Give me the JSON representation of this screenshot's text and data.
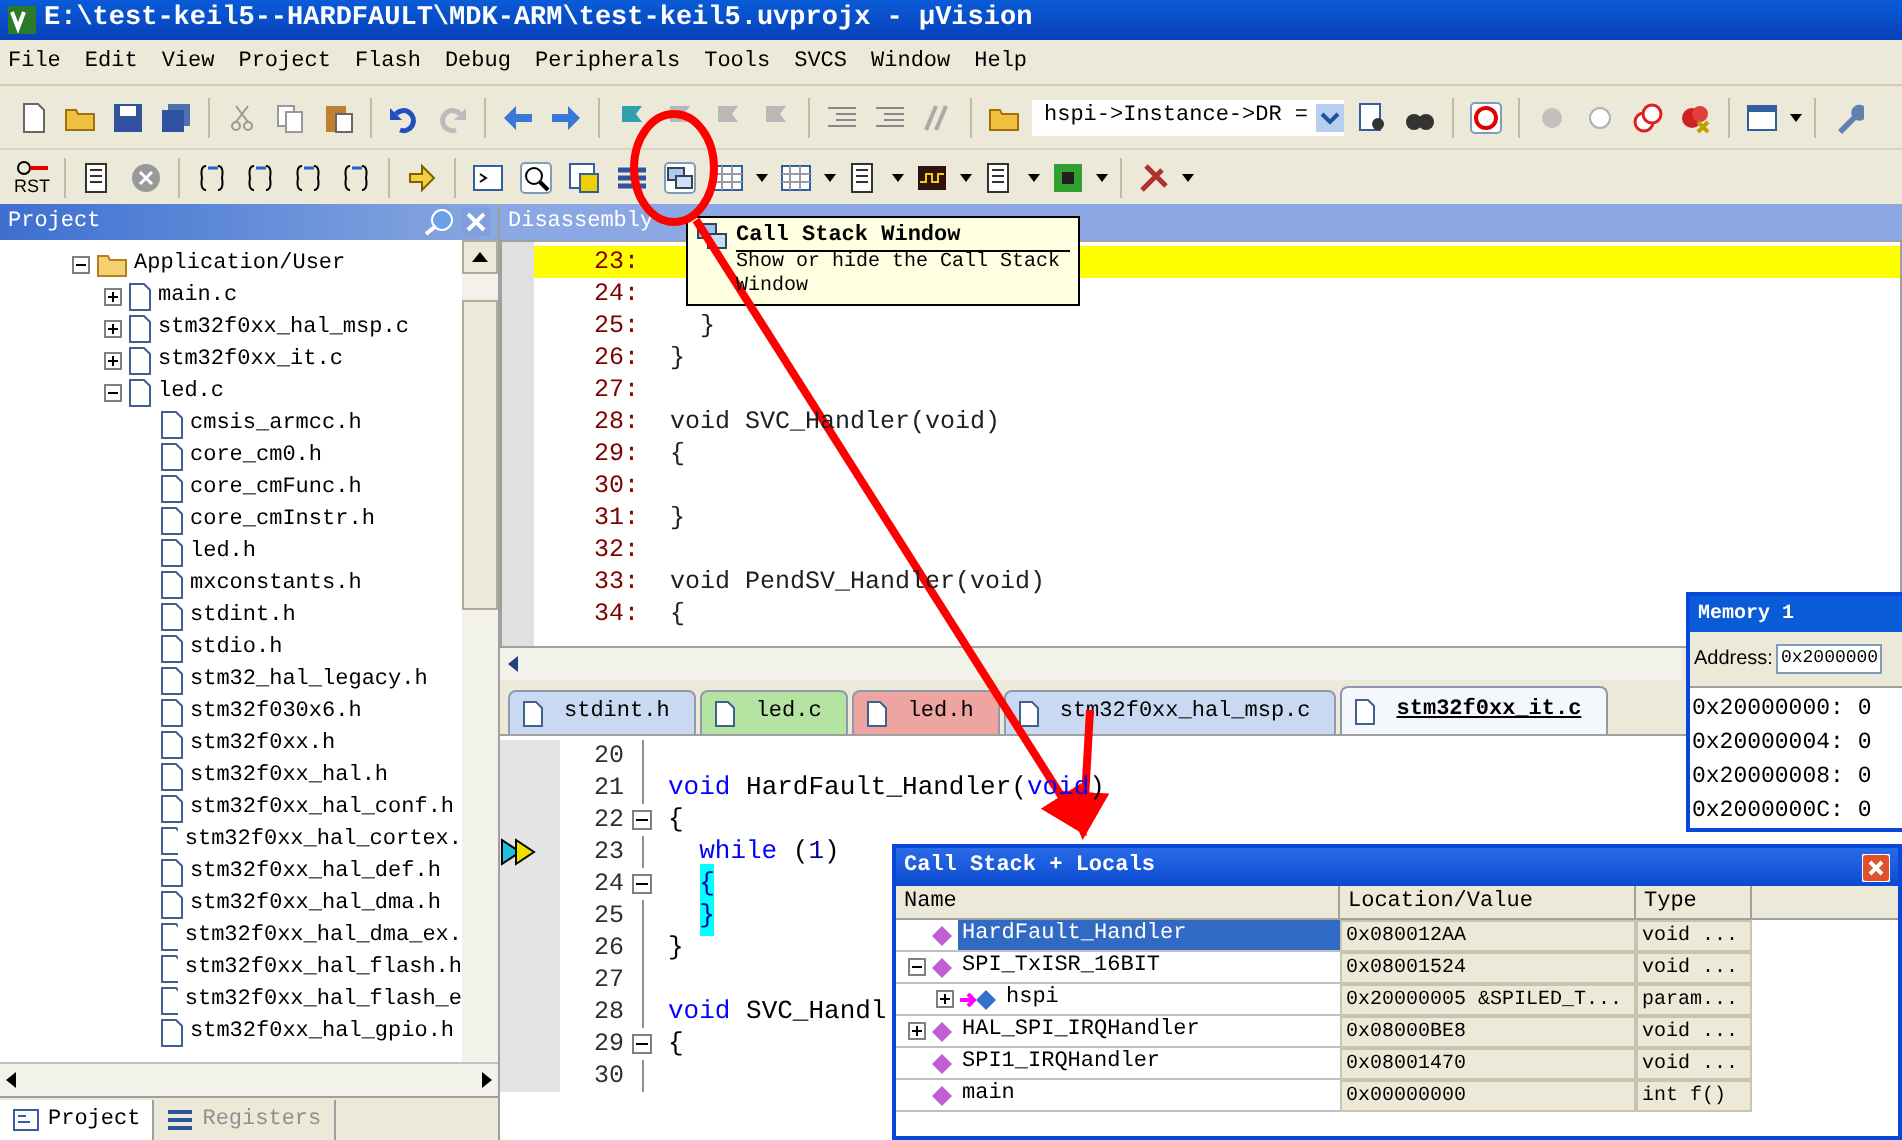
{
  "window": {
    "title": "E:\\test-keil5--HARDFAULT\\MDK-ARM\\test-keil5.uvprojx - µVision"
  },
  "menu": [
    "File",
    "Edit",
    "View",
    "Project",
    "Flash",
    "Debug",
    "Peripherals",
    "Tools",
    "SVCS",
    "Window",
    "Help"
  ],
  "toolbar": {
    "find_field": {
      "value": "hspi->Instance->DR ="
    },
    "reset_label": "RST"
  },
  "project_panel": {
    "title": "Project",
    "tree": [
      {
        "label": "Application/User",
        "kind": "folder",
        "expanded": true,
        "children": [
          {
            "label": "main.c",
            "kind": "file",
            "expanded": false
          },
          {
            "label": "stm32f0xx_hal_msp.c",
            "kind": "file",
            "expanded": false
          },
          {
            "label": "stm32f0xx_it.c",
            "kind": "file",
            "expanded": false
          },
          {
            "label": "led.c",
            "kind": "file",
            "expanded": true,
            "children": [
              {
                "label": "cmsis_armcc.h",
                "kind": "file"
              },
              {
                "label": "core_cm0.h",
                "kind": "file"
              },
              {
                "label": "core_cmFunc.h",
                "kind": "file"
              },
              {
                "label": "core_cmInstr.h",
                "kind": "file"
              },
              {
                "label": "led.h",
                "kind": "file"
              },
              {
                "label": "mxconstants.h",
                "kind": "file"
              },
              {
                "label": "stdint.h",
                "kind": "file"
              },
              {
                "label": "stdio.h",
                "kind": "file"
              },
              {
                "label": "stm32_hal_legacy.h",
                "kind": "file"
              },
              {
                "label": "stm32f030x6.h",
                "kind": "file"
              },
              {
                "label": "stm32f0xx.h",
                "kind": "file"
              },
              {
                "label": "stm32f0xx_hal.h",
                "kind": "file"
              },
              {
                "label": "stm32f0xx_hal_conf.h",
                "kind": "file"
              },
              {
                "label": "stm32f0xx_hal_cortex.",
                "kind": "file"
              },
              {
                "label": "stm32f0xx_hal_def.h",
                "kind": "file"
              },
              {
                "label": "stm32f0xx_hal_dma.h",
                "kind": "file"
              },
              {
                "label": "stm32f0xx_hal_dma_ex.",
                "kind": "file"
              },
              {
                "label": "stm32f0xx_hal_flash.h",
                "kind": "file"
              },
              {
                "label": "stm32f0xx_hal_flash_e",
                "kind": "file"
              },
              {
                "label": "stm32f0xx_hal_gpio.h",
                "kind": "file"
              }
            ]
          }
        ]
      }
    ],
    "tabs": [
      {
        "label": "Project",
        "selected": true
      },
      {
        "label": "Registers",
        "selected": false
      }
    ]
  },
  "disassembly": {
    "title": "Disassembly",
    "lines": [
      {
        "number": "23:",
        "current": true
      },
      {
        "number": "24:",
        "current": false
      },
      {
        "number": "25:",
        "text": "  }",
        "current": false
      },
      {
        "number": "26:",
        "text": "}",
        "current": false
      },
      {
        "number": "27:",
        "current": false
      },
      {
        "number": "28:",
        "text": "void SVC_Handler(void)",
        "current": false
      },
      {
        "number": "29:",
        "text": "{",
        "current": false
      },
      {
        "number": "30:",
        "current": false
      },
      {
        "number": "31:",
        "text": "}",
        "current": false
      },
      {
        "number": "32:",
        "current": false
      },
      {
        "number": "33:",
        "text": "void PendSV_Handler(void)",
        "current": false
      },
      {
        "number": "34:",
        "text": "{",
        "current": false
      }
    ]
  },
  "tooltip": {
    "title": "Call Stack Window",
    "text": "Show or hide the Call Stack Window"
  },
  "editor": {
    "tabs": [
      {
        "label": "stdint.h",
        "color": "#c9d9f1",
        "selected": false
      },
      {
        "label": "led.c",
        "color": "#b5e3a1",
        "selected": false
      },
      {
        "label": "led.h",
        "color": "#eea4a0",
        "selected": false
      },
      {
        "label": "stm32f0xx_hal_msp.c",
        "color": "#c9d9f1",
        "selected": false
      },
      {
        "label": "stm32f0xx_it.c",
        "color": "#f4f7fc",
        "selected": true
      }
    ],
    "lines": [
      {
        "number": "20",
        "fold": false,
        "current": false
      },
      {
        "number": "21",
        "fold": false,
        "current": false,
        "tokens": [
          {
            "text": "void",
            "kind": "keyword"
          },
          {
            "text": " HardFault_Handler(",
            "kind": "plain"
          },
          {
            "text": "void",
            "kind": "keyword"
          },
          {
            "text": ")",
            "kind": "plain"
          }
        ]
      },
      {
        "number": "22",
        "fold": true,
        "current": false,
        "tokens": [
          {
            "text": "{",
            "kind": "plain"
          }
        ]
      },
      {
        "number": "23",
        "fold": false,
        "current": true,
        "tokens": [
          {
            "text": "  while",
            "kind": "keyword"
          },
          {
            "text": " (",
            "kind": "plain"
          },
          {
            "text": "1",
            "kind": "number"
          },
          {
            "text": ")",
            "kind": "plain"
          }
        ]
      },
      {
        "number": "24",
        "fold": true,
        "current": false,
        "tokens": [
          {
            "text": "  {",
            "kind": "brace_match"
          }
        ]
      },
      {
        "number": "25",
        "fold": false,
        "current": false,
        "tokens": [
          {
            "text": "  }",
            "kind": "brace_match"
          }
        ]
      },
      {
        "number": "26",
        "fold": false,
        "current": false,
        "tokens": [
          {
            "text": "}",
            "kind": "plain"
          }
        ]
      },
      {
        "number": "27",
        "fold": false,
        "current": false
      },
      {
        "number": "28",
        "fold": false,
        "current": false,
        "tokens": [
          {
            "text": "void",
            "kind": "keyword"
          },
          {
            "text": " SVC_Handl",
            "kind": "plain"
          }
        ]
      },
      {
        "number": "29",
        "fold": true,
        "current": false,
        "tokens": [
          {
            "text": "{",
            "kind": "plain"
          }
        ]
      },
      {
        "number": "30",
        "fold": false,
        "current": false
      }
    ]
  },
  "memory": {
    "title": "Memory 1",
    "address_label": "Address:",
    "address": "0x2000000",
    "rows": [
      "0x20000000: 0",
      "0x20000004: 0",
      "0x20000008: 0",
      "0x2000000C: 0"
    ]
  },
  "call_stack": {
    "title": "Call Stack + Locals",
    "columns": [
      "Name",
      "Location/Value",
      "Type"
    ],
    "rows": [
      {
        "name": "HardFault_Handler",
        "kind": "function",
        "selected": true,
        "value": "0x080012AA",
        "type": "void ..."
      },
      {
        "name": "SPI_TxISR_16BIT",
        "kind": "function",
        "expanded": true,
        "selected": false,
        "value": "0x08001524",
        "type": "void ...",
        "children": [
          {
            "name": "hspi",
            "kind": "parameter",
            "expanded": false,
            "selected": false,
            "value": "0x20000005 &SPILED_T...",
            "type": "param..."
          }
        ]
      },
      {
        "name": "HAL_SPI_IRQHandler",
        "kind": "function",
        "expanded": false,
        "selected": false,
        "value": "0x08000BE8",
        "type": "void ..."
      },
      {
        "name": "SPI1_IRQHandler",
        "kind": "function",
        "selected": false,
        "value": "0x08001470",
        "type": "void ..."
      },
      {
        "name": "main",
        "kind": "function",
        "selected": false,
        "value": "0x00000000",
        "type": "int f()"
      }
    ]
  }
}
